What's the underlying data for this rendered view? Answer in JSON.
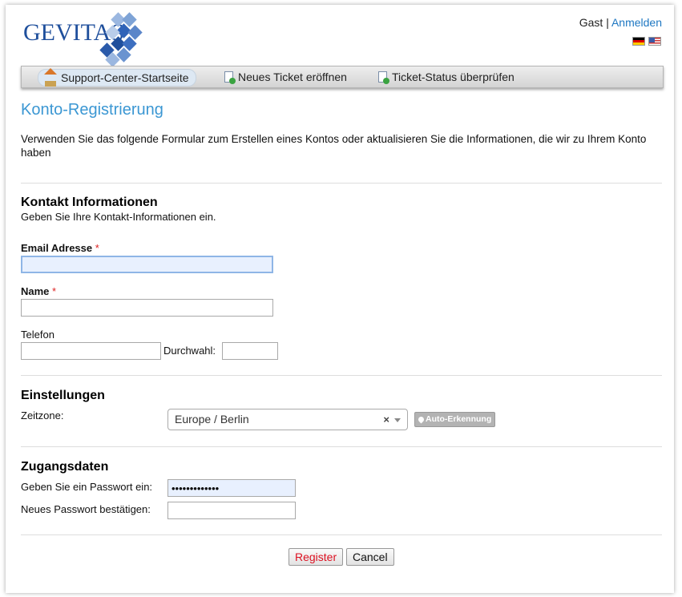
{
  "header": {
    "logo_text": "GEVITAS",
    "guest_label": "Gast",
    "separator": "|",
    "login_link": "Anmelden",
    "languages": [
      "de-flag",
      "us-flag"
    ]
  },
  "nav": {
    "items": [
      {
        "label": "Support-Center-Startseite",
        "icon": "home-icon",
        "active": true
      },
      {
        "label": "Neues Ticket eröffnen",
        "icon": "new-ticket-icon",
        "active": false
      },
      {
        "label": "Ticket-Status überprüfen",
        "icon": "ticket-status-icon",
        "active": false
      }
    ]
  },
  "page": {
    "title": "Konto-Registrierung",
    "intro": "Verwenden Sie das folgende Formular zum Erstellen eines Kontos oder aktualisieren Sie die Informationen, die wir zu Ihrem Konto haben"
  },
  "contact": {
    "title": "Kontakt Informationen",
    "subtitle": "Geben Sie Ihre Kontakt-Informationen ein.",
    "email_label": "Email Adresse",
    "required_mark": "*",
    "email_value": "",
    "name_label": "Name",
    "name_value": "",
    "phone_label": "Telefon",
    "phone_value": "",
    "ext_label": "Durchwahl:",
    "ext_value": ""
  },
  "settings": {
    "title": "Einstellungen",
    "timezone_label": "Zeitzone:",
    "timezone_value": "Europe / Berlin",
    "clear_symbol": "×",
    "auto_detect_label": "Auto-Erkennung"
  },
  "access": {
    "title": "Zugangsdaten",
    "password_label": "Geben Sie ein Passwort ein:",
    "password_value": "•••••••••••••",
    "confirm_label": "Neues Passwort bestätigen:",
    "confirm_value": ""
  },
  "actions": {
    "register_label": "Register",
    "cancel_label": "Cancel"
  },
  "colors": {
    "accent": "#3b97d3",
    "link": "#1e77c2",
    "required": "#d22222",
    "register_text": "#dd1122"
  }
}
